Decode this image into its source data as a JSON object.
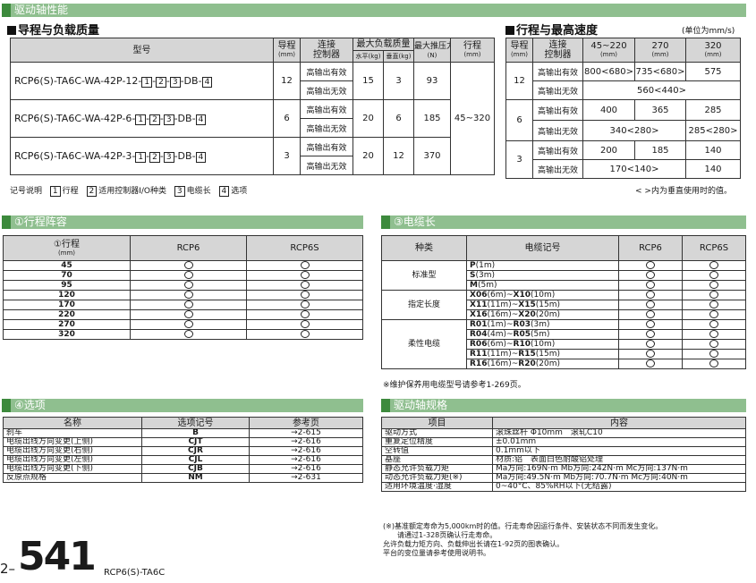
{
  "section_title": "驱动轴性能",
  "main_table": {
    "title": "导程与负载质量",
    "headers": {
      "model": "型号",
      "lead": "导程",
      "lead_unit": "(mm)",
      "controller": "连接",
      "controller2": "控制器",
      "max_load": "最大负载质量",
      "horizontal": "水平(kg)",
      "vertical": "垂直(kg)",
      "max_thrust": "最大推压力",
      "thrust_unit": "(N)",
      "stroke": "行程",
      "stroke_unit": "(mm)"
    },
    "rows": [
      {
        "prefix": "RCP6(S)-TA6C-WA-42P-12-",
        "lead": "12",
        "c1": "高输出有效",
        "c2": "高输出无效",
        "h": "15",
        "v": "3",
        "thrust": "93"
      },
      {
        "prefix": "RCP6(S)-TA6C-WA-42P-6-",
        "lead": "6",
        "c1": "高输出有效",
        "c2": "高输出无效",
        "h": "20",
        "v": "6",
        "thrust": "185"
      },
      {
        "prefix": "RCP6(S)-TA6C-WA-42P-3-",
        "lead": "3",
        "c1": "高输出有效",
        "c2": "高输出无效",
        "h": "20",
        "v": "12",
        "thrust": "370"
      }
    ],
    "stroke_range": "45~320",
    "boxes": [
      "1",
      "2",
      "3",
      "4"
    ],
    "db": "DB"
  },
  "legend": {
    "label": "记号说明",
    "items": [
      {
        "n": "1",
        "t": "行程"
      },
      {
        "n": "2",
        "t": "适用控制器I/O种类"
      },
      {
        "n": "3",
        "t": "电缆长"
      },
      {
        "n": "4",
        "t": "选项"
      }
    ]
  },
  "speed_table": {
    "title": "行程与最高速度",
    "unit_note": "(单位为mm/s)",
    "headers": {
      "lead": "导程",
      "lead_unit": "(mm)",
      "controller": "连接",
      "controller2": "控制器",
      "c1": "45~220",
      "c2": "270",
      "c3": "320",
      "mm": "(mm)"
    },
    "rows": [
      {
        "lead": "12",
        "a": {
          "ctl": "高输出有效",
          "v": [
            "800<680>",
            "735<680>",
            "575"
          ]
        },
        "b": {
          "ctl": "高输出无效",
          "span": "560<440>"
        }
      },
      {
        "lead": "6",
        "a": {
          "ctl": "高输出有效",
          "v": [
            "400",
            "365",
            "285"
          ]
        },
        "b": {
          "ctl": "高输出无效",
          "span": "340<280>",
          "last": "285<280>"
        }
      },
      {
        "lead": "3",
        "a": {
          "ctl": "高输出有效",
          "v": [
            "200",
            "185",
            "140"
          ]
        },
        "b": {
          "ctl": "高输出无效",
          "span": "170<140>",
          "last": "140"
        }
      }
    ],
    "note": "< >内为垂直使用时的值。"
  },
  "stroke_table": {
    "title": "①行程阵容",
    "headers": {
      "stroke": "①行程",
      "unit": "(mm)",
      "rcp6": "RCP6",
      "rcp6s": "RCP6S"
    },
    "rows": [
      "45",
      "70",
      "95",
      "120",
      "170",
      "220",
      "270",
      "320"
    ]
  },
  "cable_table": {
    "title": "③电缆长",
    "headers": {
      "type": "种类",
      "code": "电缆记号",
      "rcp6": "RCP6",
      "rcp6s": "RCP6S"
    },
    "groups": [
      {
        "type": "标准型",
        "rows": [
          {
            "a": "P",
            "an": "(1m)"
          },
          {
            "a": "S",
            "an": "(3m)"
          },
          {
            "a": "M",
            "an": "(5m)"
          }
        ]
      },
      {
        "type": "指定长度",
        "rows": [
          {
            "a": "X06",
            "an": "(6m)",
            "b": "X10",
            "bn": "(10m)"
          },
          {
            "a": "X11",
            "an": "(11m)",
            "b": "X15",
            "bn": "(15m)"
          },
          {
            "a": "X16",
            "an": "(16m)",
            "b": "X20",
            "bn": "(20m)"
          }
        ]
      },
      {
        "type": "柔性电缆",
        "rows": [
          {
            "a": "R01",
            "an": "(1m)",
            "b": "R03",
            "bn": "(3m)"
          },
          {
            "a": "R04",
            "an": "(4m)",
            "b": "R05",
            "bn": "(5m)"
          },
          {
            "a": "R06",
            "an": "(6m)",
            "b": "R10",
            "bn": "(10m)"
          },
          {
            "a": "R11",
            "an": "(11m)",
            "b": "R15",
            "bn": "(15m)"
          },
          {
            "a": "R16",
            "an": "(16m)",
            "b": "R20",
            "bn": "(20m)"
          }
        ]
      }
    ],
    "tilde": "~",
    "note": "※维护保养用电缆型号请参考1-269页。"
  },
  "option_table": {
    "title": "④选项",
    "headers": {
      "name": "名称",
      "code": "选项记号",
      "page": "参考页"
    },
    "rows": [
      {
        "name": "刹车",
        "code": "B",
        "page": "→2-615"
      },
      {
        "name": "电缆出线方向变更(上侧)",
        "code": "CJT",
        "page": "→2-616"
      },
      {
        "name": "电缆出线方向变更(右侧)",
        "code": "CJR",
        "page": "→2-616"
      },
      {
        "name": "电缆出线方向变更(左侧)",
        "code": "CJL",
        "page": "→2-616"
      },
      {
        "name": "电缆出线方向变更(下侧)",
        "code": "CJB",
        "page": "→2-616"
      },
      {
        "name": "反原点规格",
        "code": "NM",
        "page": "→2-631"
      }
    ]
  },
  "spec_table": {
    "title": "驱动轴规格",
    "headers": {
      "item": "项目",
      "content": "内容"
    },
    "rows": [
      {
        "item": "驱动方式",
        "content": "滚珠丝杆 Φ10mm　滚轧C10"
      },
      {
        "item": "重复定位精度",
        "content": "±0.01mm"
      },
      {
        "item": "空转值",
        "content": "0.1mm以下"
      },
      {
        "item": "基座",
        "content": "材质:铝　表面白色耐酸铝处理"
      },
      {
        "item": "静态允许负载力矩",
        "content": "Ma方向:169N·m Mb方向:242N·m Mc方向:137N·m"
      },
      {
        "item": "动态允许负载力矩(※)",
        "content": "Ma方向:49.5N·m Mb方向:70.7N·m Mc方向:40N·m"
      },
      {
        "item": "适用环境温度·湿度",
        "content": "0~40°C、85%RH以下(无结露)"
      }
    ],
    "notes": [
      "(※)基准额定寿命为5,000km时的值。行走寿命因运行条件、安装状态不同而发生变化。",
      "　　请通过1-328页确认行走寿命。",
      "允许负载力矩方向、负载伸出长请在1-92页的图表确认。",
      "平台的变位量请参考使用说明书。"
    ]
  },
  "footer": {
    "prefix": "2–",
    "page": "541",
    "model": "RCP6(S)-TA6C"
  }
}
